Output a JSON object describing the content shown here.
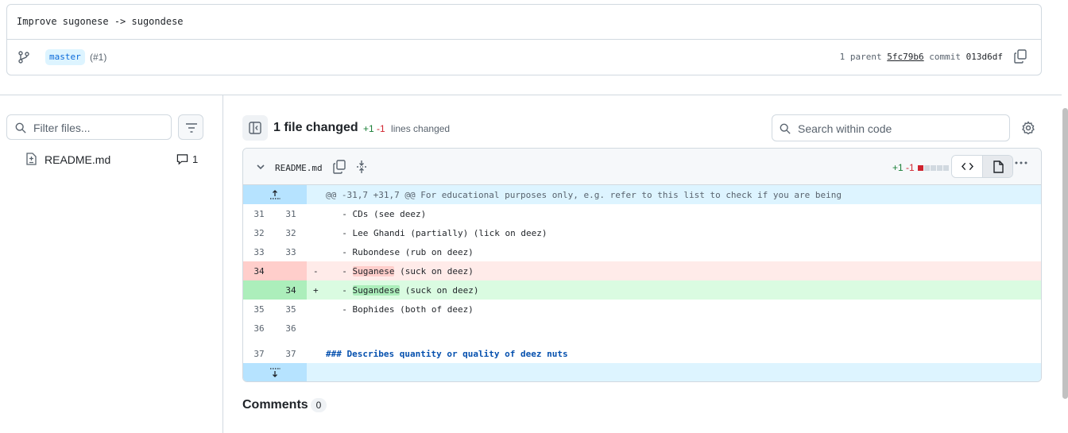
{
  "commit": {
    "message": "Improve sugonese -> sugondese",
    "branch": "master",
    "pr_ref": "(#1)",
    "parent_label": "1 parent",
    "parent_hash": "5fc79b6",
    "commit_label": "commit",
    "commit_hash": "013d6df"
  },
  "sidebar": {
    "filter_placeholder": "Filter files...",
    "files": [
      {
        "name": "README.md",
        "comments": "1"
      }
    ]
  },
  "toolbar": {
    "files_changed": "1 file changed",
    "additions": "+1",
    "deletions": "-1",
    "lines_changed_label": "lines changed",
    "search_placeholder": "Search within code"
  },
  "diff": {
    "filename": "README.md",
    "additions": "+1",
    "deletions": "-1",
    "hunk_header": "@@ -31,7 +31,7 @@ For educational purposes only, e.g. refer to this list to check if you are being",
    "lines": [
      {
        "old": "31",
        "new": "31",
        "sign": "",
        "text": "  - CDs (see deez)"
      },
      {
        "old": "32",
        "new": "32",
        "sign": "",
        "text": "  - Lee Ghandi (partially) (lick on deez)"
      },
      {
        "old": "33",
        "new": "33",
        "sign": "",
        "text": "  - Rubondese (rub on deez)"
      },
      {
        "old": "34",
        "new": "",
        "sign": "-",
        "prefix": "  - ",
        "mark": "Suganese",
        "rest": " (suck on deez)"
      },
      {
        "old": "",
        "new": "34",
        "sign": "+",
        "prefix": "  - ",
        "mark": "Sugandese",
        "rest": " (suck on deez)"
      },
      {
        "old": "35",
        "new": "35",
        "sign": "",
        "text": "  - Bophides (both of deez)"
      },
      {
        "old": "36",
        "new": "36",
        "sign": "",
        "text": ""
      },
      {
        "old": "37",
        "new": "37",
        "sign": "",
        "text": "### Describes quantity or quality of deez nuts"
      }
    ]
  },
  "comments": {
    "label": "Comments",
    "count": "0"
  },
  "colors": {
    "add": "#1a7f37",
    "del": "#d1242f",
    "accent": "#0969da"
  }
}
